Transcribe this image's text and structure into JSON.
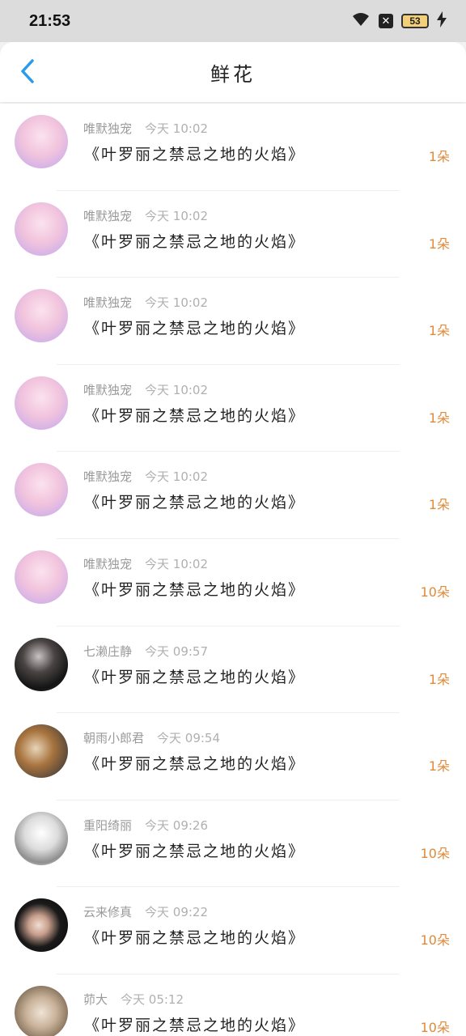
{
  "status": {
    "time": "21:53",
    "battery": "53"
  },
  "header": {
    "title": "鲜花"
  },
  "items": [
    {
      "name": "唯默独宠",
      "time": "今天 10:02",
      "book": "《叶罗丽之禁忌之地的火焰》",
      "count": "1朵",
      "avatar": "pink"
    },
    {
      "name": "唯默独宠",
      "time": "今天 10:02",
      "book": "《叶罗丽之禁忌之地的火焰》",
      "count": "1朵",
      "avatar": "pink"
    },
    {
      "name": "唯默独宠",
      "time": "今天 10:02",
      "book": "《叶罗丽之禁忌之地的火焰》",
      "count": "1朵",
      "avatar": "pink"
    },
    {
      "name": "唯默独宠",
      "time": "今天 10:02",
      "book": "《叶罗丽之禁忌之地的火焰》",
      "count": "1朵",
      "avatar": "pink"
    },
    {
      "name": "唯默独宠",
      "time": "今天 10:02",
      "book": "《叶罗丽之禁忌之地的火焰》",
      "count": "1朵",
      "avatar": "pink"
    },
    {
      "name": "唯默独宠",
      "time": "今天 10:02",
      "book": "《叶罗丽之禁忌之地的火焰》",
      "count": "10朵",
      "avatar": "pink"
    },
    {
      "name": "七濑庄静",
      "time": "今天 09:57",
      "book": "《叶罗丽之禁忌之地的火焰》",
      "count": "1朵",
      "avatar": "dark"
    },
    {
      "name": "朝雨小郎君",
      "time": "今天 09:54",
      "book": "《叶罗丽之禁忌之地的火焰》",
      "count": "1朵",
      "avatar": "warm"
    },
    {
      "name": "重阳绮丽",
      "time": "今天 09:26",
      "book": "《叶罗丽之禁忌之地的火焰》",
      "count": "10朵",
      "avatar": "sketch"
    },
    {
      "name": "云来修真",
      "time": "今天 09:22",
      "book": "《叶罗丽之禁忌之地的火焰》",
      "count": "10朵",
      "avatar": "black"
    },
    {
      "name": "茆大",
      "time": "今天 05:12",
      "book": "《叶罗丽之禁忌之地的火焰》",
      "count": "10朵",
      "avatar": "stone"
    }
  ]
}
